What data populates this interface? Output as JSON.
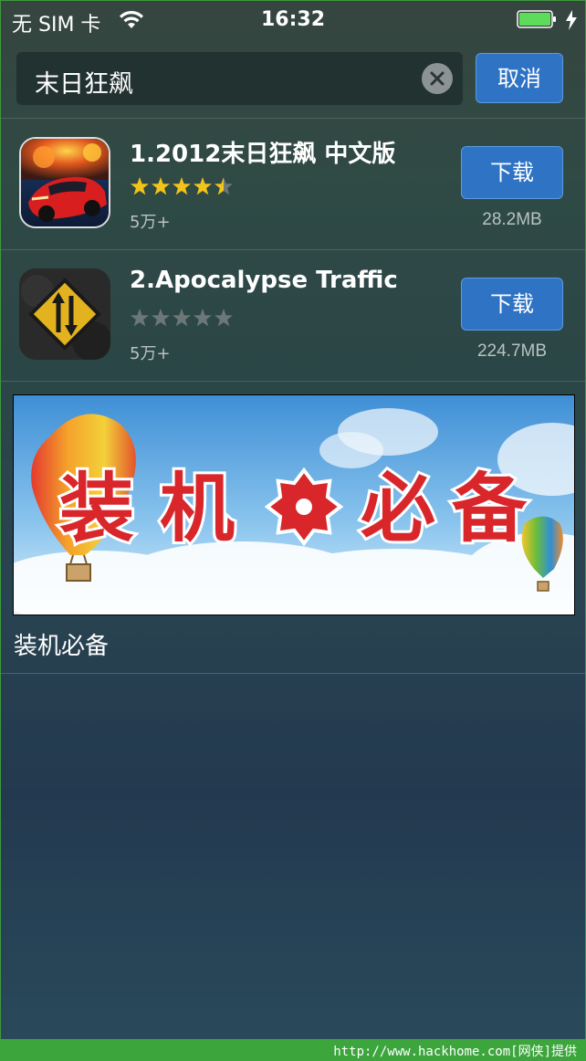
{
  "status_bar": {
    "carrier": "无 SIM 卡",
    "time": "16:32",
    "battery_color": "#5ddc5a"
  },
  "search": {
    "query": "末日狂飙",
    "cancel_label": "取消",
    "clear_icon": "clear-x-icon"
  },
  "results": [
    {
      "title": "1.2012末日狂飙 中文版",
      "rating": 4.5,
      "downloads": "5万+",
      "button_label": "下载",
      "size": "28.2MB",
      "icon": "race-car-icon"
    },
    {
      "title": "2.Apocalypse Traffic",
      "rating": 0,
      "downloads": "5万+",
      "button_label": "下载",
      "size": "224.7MB",
      "icon": "two-way-traffic-sign-icon"
    }
  ],
  "banner": {
    "image_text": "装机必备",
    "caption": "装机必备"
  },
  "footer": {
    "watermark": "http://www.hackhome.com[网侠]提供",
    "color": "#3ca53c"
  },
  "colors": {
    "button_blue": "#2e73c4",
    "star_gold": "#f2c31a",
    "star_gray": "#6c7878"
  }
}
